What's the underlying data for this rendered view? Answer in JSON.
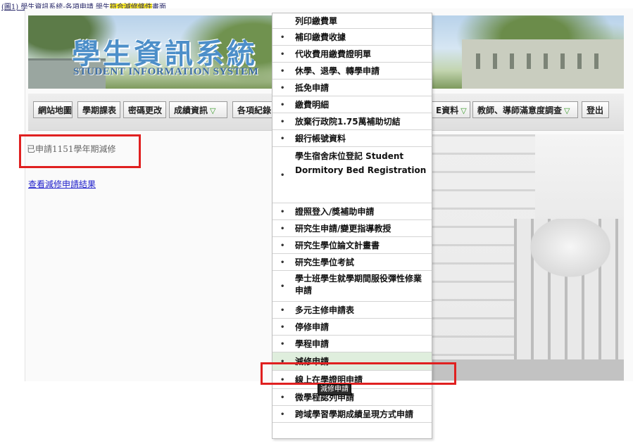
{
  "caption": {
    "prefix": "(圖1) 學生資訊系統-各項申請 學生",
    "highlight": "符合減修條件",
    "suffix": "畫面"
  },
  "header": {
    "title_cn": "學生資訊系統",
    "title_en": "STUDENT INFORMATION SYSTEM"
  },
  "nav": {
    "items": [
      {
        "label": "網站地圖",
        "dropdown": false
      },
      {
        "label": "學期課表",
        "dropdown": false
      },
      {
        "label": "密碼更改",
        "dropdown": false
      },
      {
        "label": "成績資訊",
        "dropdown": true
      },
      {
        "label": "各項紀錄",
        "dropdown": true
      },
      {
        "label": "E資料",
        "dropdown": true
      },
      {
        "label": "教師、導師滿意度調查",
        "dropdown": true
      },
      {
        "label": "登出",
        "dropdown": false
      }
    ]
  },
  "status": {
    "applied_text": "已申請1151學年期減修",
    "result_link": "查看減修申請結果"
  },
  "menu": {
    "items": [
      {
        "label": "列印繳費單"
      },
      {
        "label": "補印繳費收據"
      },
      {
        "label": "代收費用繳費證明單"
      },
      {
        "label": "休學、退學、轉學申請"
      },
      {
        "label": "抵免申請"
      },
      {
        "label": "繳費明細"
      },
      {
        "label": "放棄行政院1.75萬補助切結"
      },
      {
        "label": "銀行帳號資料"
      },
      {
        "label": "學生宿舍床位登記 Student Dormitory Bed Registration"
      },
      {
        "label": "證照登入/獎補助申請"
      },
      {
        "label": "研究生申請/變更指導教授"
      },
      {
        "label": "研究生學位論文計畫書"
      },
      {
        "label": "研究生學位考試"
      },
      {
        "label": "學士班學生就學期間服役彈性修業申請"
      },
      {
        "label": "多元主修申請表"
      },
      {
        "label": "停修申請"
      },
      {
        "label": "學程申請"
      },
      {
        "label": "減修申請",
        "selected": true
      },
      {
        "label": "線上在學證明申請"
      },
      {
        "label": "微學程認列申請"
      },
      {
        "label": "跨域學習學期成績呈現方式申請"
      }
    ],
    "bullet": "•"
  },
  "tooltip": "減修申請",
  "colors": {
    "highlight_box": "#e02020",
    "menu_selected_bg": "#dfeedd",
    "link": "#2222cc",
    "caption_highlight": "#ffee22",
    "title": "#4d8fc9"
  }
}
